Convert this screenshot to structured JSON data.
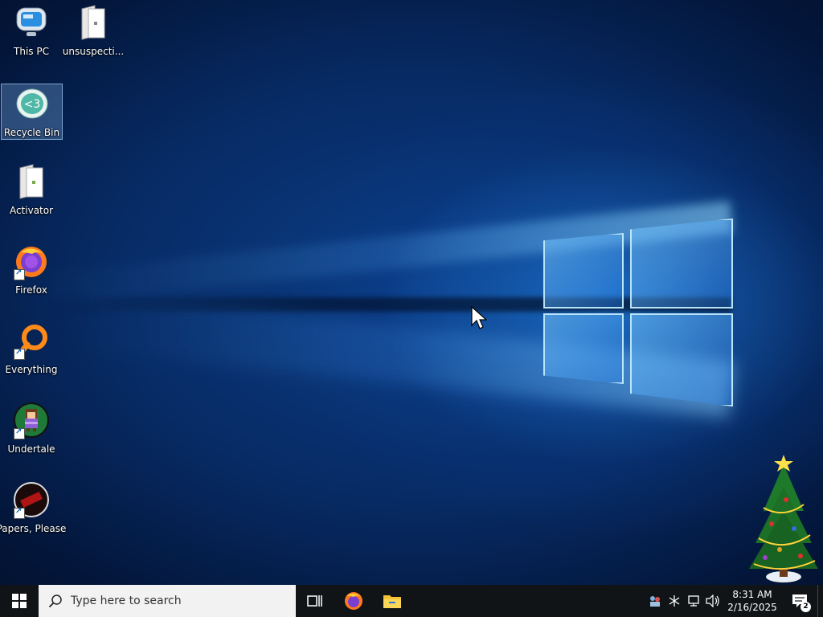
{
  "desktop_icons": [
    {
      "label": "This PC",
      "icon": "computer-icon"
    },
    {
      "label": "unsuspecti...",
      "icon": "file-icon"
    },
    {
      "label": "Recycle Bin",
      "icon": "recycle-bin-icon"
    },
    {
      "label": "Activator",
      "icon": "file-icon"
    },
    {
      "label": "Firefox",
      "icon": "firefox-icon"
    },
    {
      "label": "Everything",
      "icon": "everything-search-icon"
    },
    {
      "label": "Undertale",
      "icon": "undertale-icon"
    },
    {
      "label": "Papers, Please",
      "icon": "papers-please-icon"
    }
  ],
  "taskbar": {
    "search_placeholder": "Type here to search",
    "clock_time": "8:31 AM",
    "clock_date": "2/16/2025",
    "notification_count": "2",
    "pinned": [
      "task-view-icon",
      "firefox-icon",
      "file-explorer-icon"
    ]
  },
  "colors": {
    "taskbar_bg": "#101417",
    "desktop_blue": "#0b3d86",
    "accent": "#1a5fb4"
  }
}
